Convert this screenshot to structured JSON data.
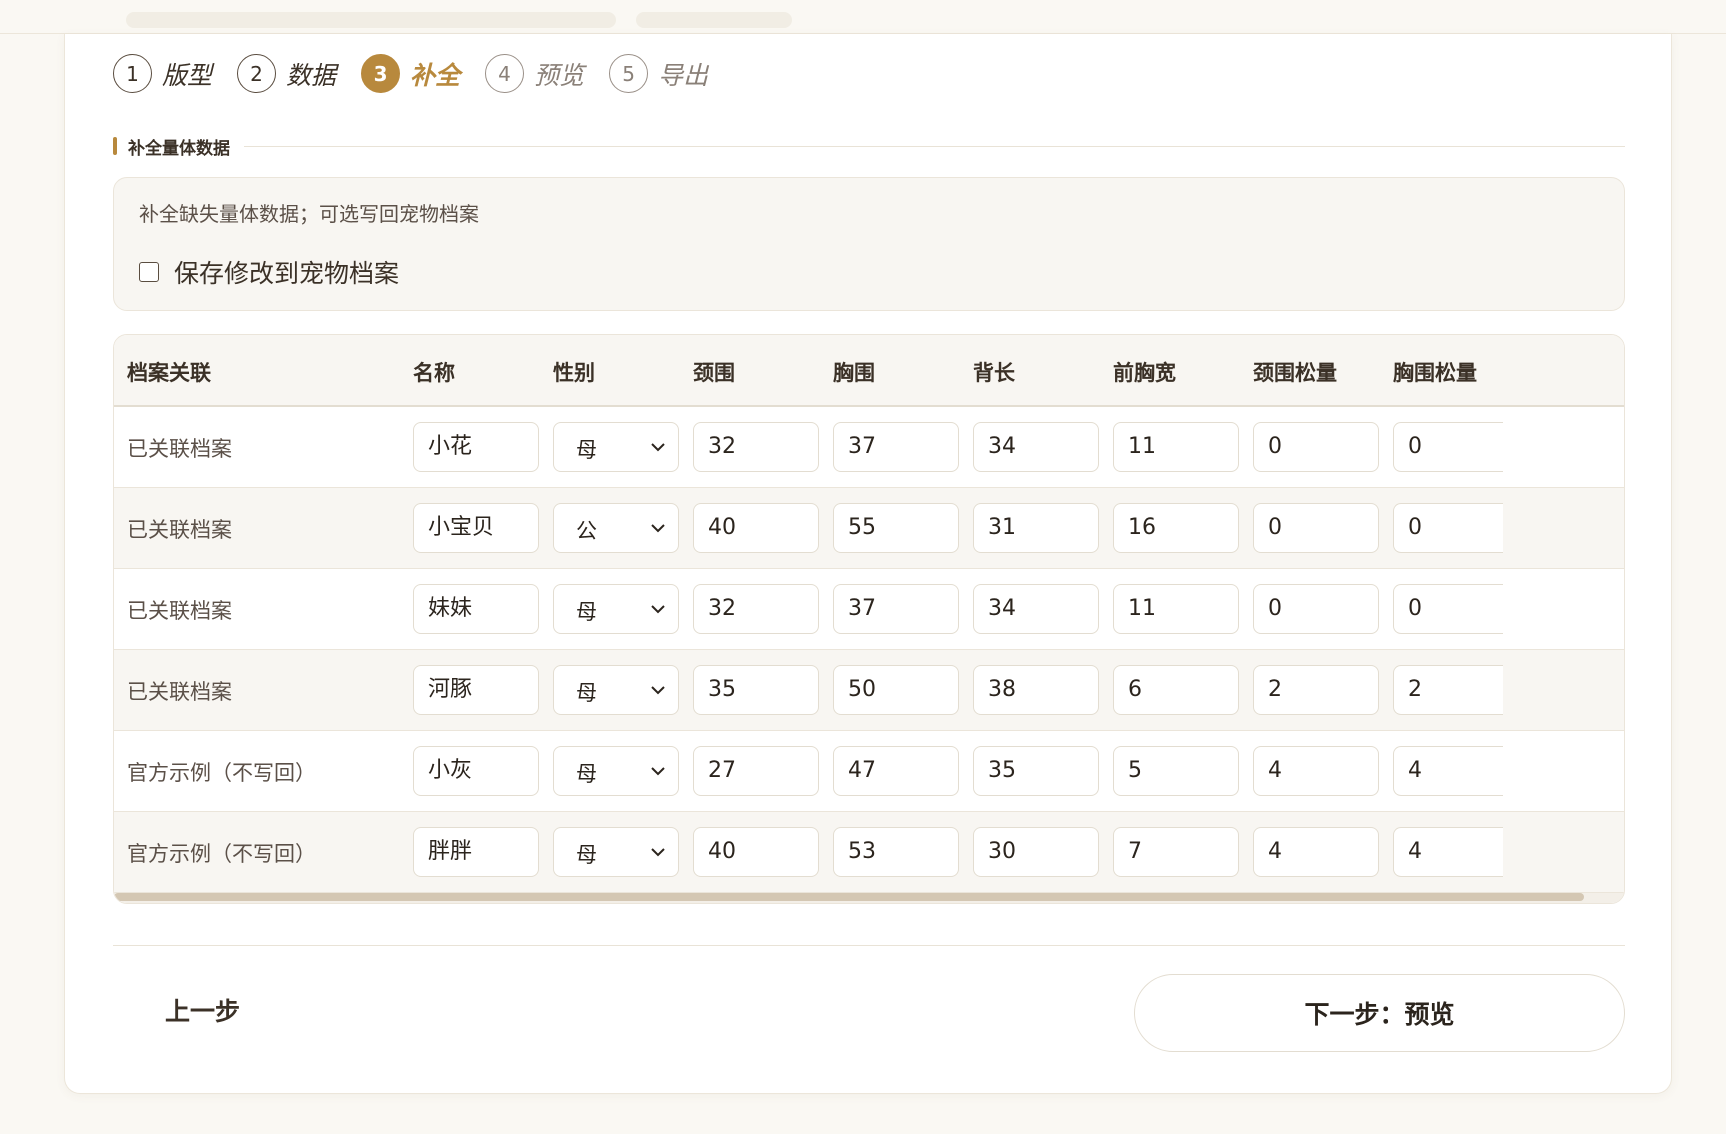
{
  "steps": [
    {
      "num": "1",
      "label": "版型",
      "state": "done"
    },
    {
      "num": "2",
      "label": "数据",
      "state": "done"
    },
    {
      "num": "3",
      "label": "补全",
      "state": "active"
    },
    {
      "num": "4",
      "label": "预览",
      "state": "future"
    },
    {
      "num": "5",
      "label": "导出",
      "state": "future"
    }
  ],
  "section": {
    "title": "补全量体数据"
  },
  "info": {
    "description": "补全缺失量体数据；可选写回宠物档案",
    "save_checkbox_label": "保存修改到宠物档案",
    "save_checked": false
  },
  "table": {
    "columns": [
      "档案关联",
      "名称",
      "性别",
      "颈围",
      "胸围",
      "背长",
      "前胸宽",
      "颈围松量",
      "胸围松量"
    ],
    "rows": [
      {
        "link": "已关联档案",
        "name": "小花",
        "gender": "母",
        "neck": "32",
        "chest": "37",
        "back": "34",
        "front_chest": "11",
        "neck_ease": "0",
        "chest_ease": "0"
      },
      {
        "link": "已关联档案",
        "name": "小宝贝",
        "gender": "公",
        "neck": "40",
        "chest": "55",
        "back": "31",
        "front_chest": "16",
        "neck_ease": "0",
        "chest_ease": "0"
      },
      {
        "link": "已关联档案",
        "name": "妹妹",
        "gender": "母",
        "neck": "32",
        "chest": "37",
        "back": "34",
        "front_chest": "11",
        "neck_ease": "0",
        "chest_ease": "0"
      },
      {
        "link": "已关联档案",
        "name": "河豚",
        "gender": "母",
        "neck": "35",
        "chest": "50",
        "back": "38",
        "front_chest": "6",
        "neck_ease": "2",
        "chest_ease": "2"
      },
      {
        "link": "官方示例（不写回）",
        "name": "小灰",
        "gender": "母",
        "neck": "27",
        "chest": "47",
        "back": "35",
        "front_chest": "5",
        "neck_ease": "4",
        "chest_ease": "4"
      },
      {
        "link": "官方示例（不写回）",
        "name": "胖胖",
        "gender": "母",
        "neck": "40",
        "chest": "53",
        "back": "30",
        "front_chest": "7",
        "neck_ease": "4",
        "chest_ease": "4"
      }
    ]
  },
  "footer": {
    "prev_label": "上一步",
    "next_label": "下一步：预览"
  },
  "colors": {
    "accent": "#b8893d",
    "background": "#faf8f3",
    "text": "#3b3127"
  }
}
